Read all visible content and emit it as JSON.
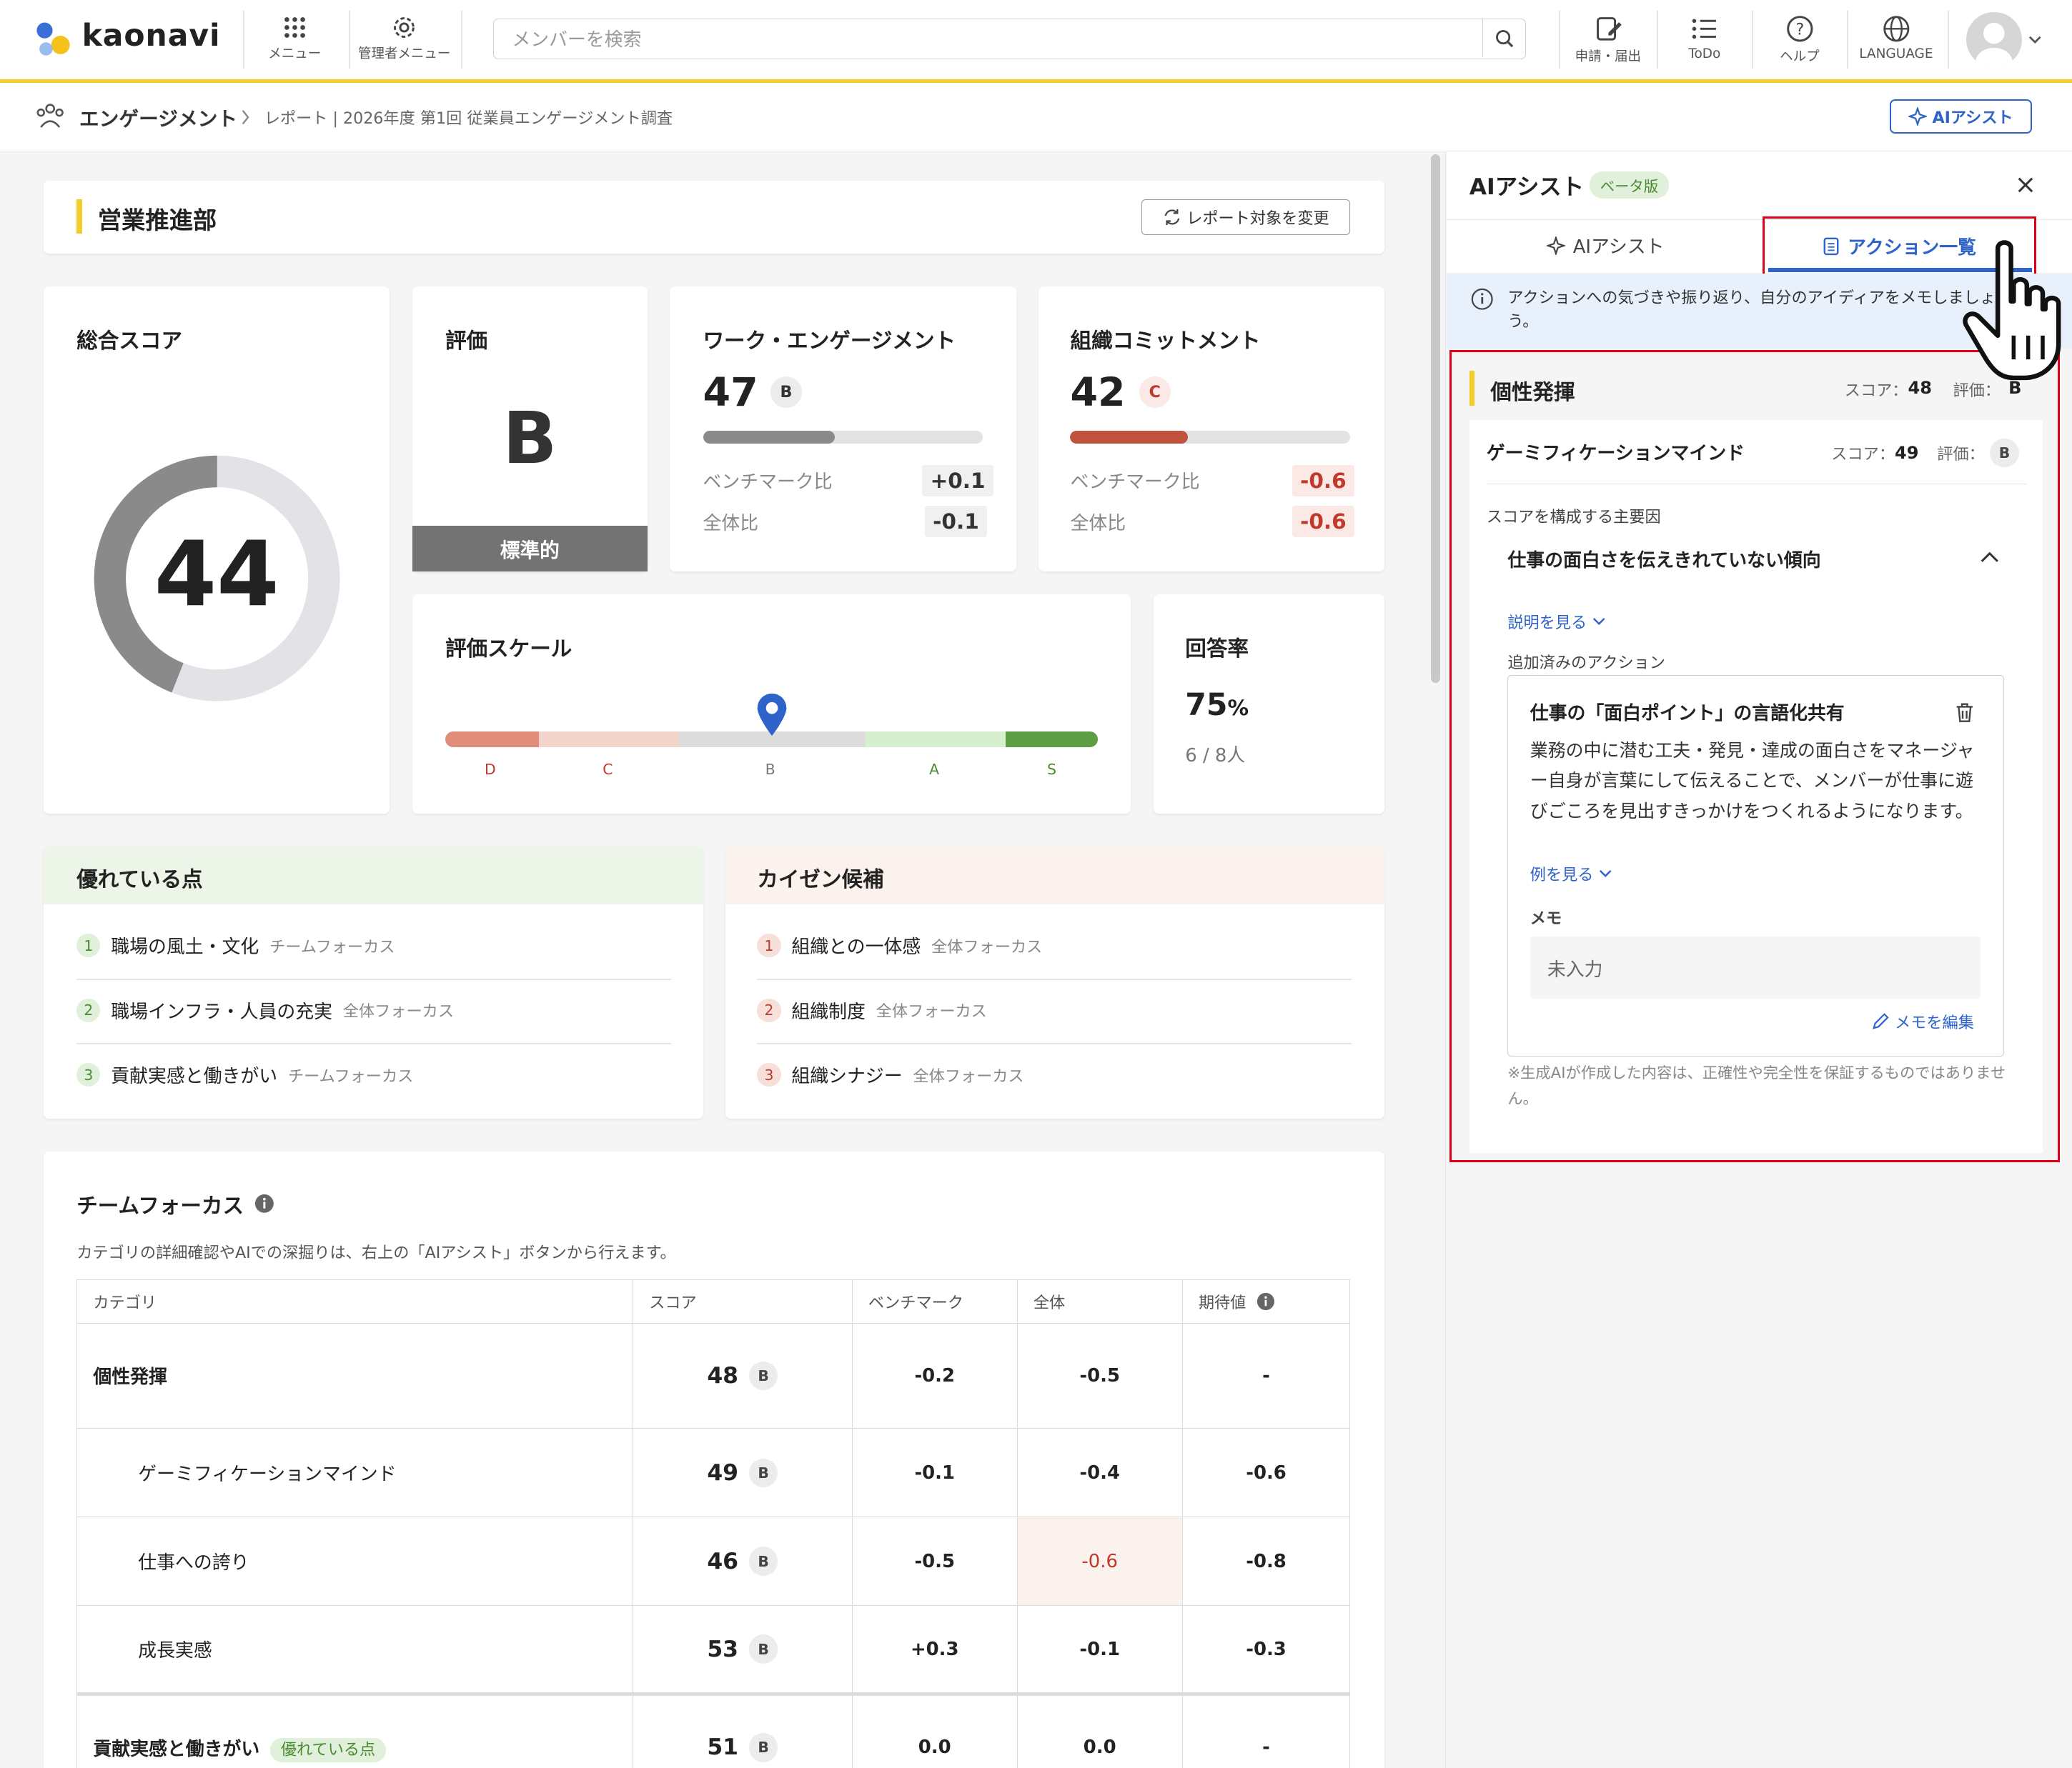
{
  "header": {
    "logo": "kaonavi",
    "nav": [
      {
        "label": "メニュー",
        "icon": "grid-icon"
      },
      {
        "label": "管理者メニュー",
        "icon": "gear-icon"
      }
    ],
    "search_placeholder": "メンバーを検索",
    "right_nav": [
      {
        "label": "申請・届出",
        "icon": "application-icon"
      },
      {
        "label": "ToDo",
        "icon": "todo-list-icon"
      },
      {
        "label": "ヘルプ",
        "icon": "help-icon"
      },
      {
        "label": "LANGUAGE",
        "icon": "globe-icon"
      }
    ]
  },
  "breadcrumb": {
    "section": "エンゲージメント",
    "report": "レポート | 2026年度 第1回 従業員エンゲージメント調査",
    "ai_button": "AIアシスト"
  },
  "department": {
    "name": "営業推進部",
    "change_button": "レポート対象を変更"
  },
  "overall": {
    "title": "総合スコア",
    "score": "44",
    "fraction": 0.44
  },
  "evaluation": {
    "title": "評価",
    "grade": "B",
    "label": "標準的"
  },
  "work_engagement": {
    "title": "ワーク・エンゲージメント",
    "score": "47",
    "grade": "B",
    "fraction": 0.47,
    "benchmark_label": "ベンチマーク比",
    "benchmark": "+0.1",
    "overall_label": "全体比",
    "overall": "-0.1"
  },
  "org_commitment": {
    "title": "組織コミットメント",
    "score": "42",
    "grade": "C",
    "fraction": 0.42,
    "benchmark_label": "ベンチマーク比",
    "benchmark": "-0.6",
    "overall_label": "全体比",
    "overall": "-0.6"
  },
  "scale": {
    "title": "評価スケール",
    "labels": [
      "D",
      "C",
      "B",
      "A",
      "S"
    ],
    "position": 0.5
  },
  "response": {
    "title": "回答率",
    "rate": "75",
    "unit": "%",
    "count": "6 / 8人"
  },
  "strengths": {
    "title": "優れている点",
    "items": [
      {
        "num": "1",
        "name": "職場の風土・文化",
        "tag": "チームフォーカス"
      },
      {
        "num": "2",
        "name": "職場インフラ・人員の充実",
        "tag": "全体フォーカス"
      },
      {
        "num": "3",
        "name": "貢献実感と働きがい",
        "tag": "チームフォーカス"
      }
    ]
  },
  "kaizen": {
    "title": "カイゼン候補",
    "items": [
      {
        "num": "1",
        "name": "組織との一体感",
        "tag": "全体フォーカス"
      },
      {
        "num": "2",
        "name": "組織制度",
        "tag": "全体フォーカス"
      },
      {
        "num": "3",
        "name": "組織シナジー",
        "tag": "全体フォーカス"
      }
    ]
  },
  "team_focus": {
    "title": "チームフォーカス",
    "description": "カテゴリの詳細確認やAIでの深掘りは、右上の「AIアシスト」ボタンから行えます。",
    "columns": [
      "カテゴリ",
      "スコア",
      "ベンチマーク",
      "全体",
      "期待値"
    ],
    "rows": [
      {
        "category": "個性発揮",
        "score": "48",
        "grade": "B",
        "benchmark": "-0.2",
        "overall": "-0.5",
        "expected": "-"
      },
      {
        "category": "ゲーミフィケーションマインド",
        "score": "49",
        "grade": "B",
        "benchmark": "-0.1",
        "overall": "-0.4",
        "expected": "-0.6"
      },
      {
        "category": "仕事への誇り",
        "score": "46",
        "grade": "B",
        "benchmark": "-0.5",
        "overall": "-0.6",
        "expected": "-0.8"
      },
      {
        "category": "成長実感",
        "score": "53",
        "grade": "B",
        "benchmark": "+0.3",
        "overall": "-0.1",
        "expected": "-0.3"
      },
      {
        "category": "貢献実感と働きがい",
        "tag": "優れている点",
        "score": "51",
        "grade": "B",
        "benchmark": "0.0",
        "overall": "0.0",
        "expected": "-"
      }
    ]
  },
  "ai_panel": {
    "title": "AIアシスト",
    "beta": "ベータ版",
    "tabs": [
      "AIアシスト",
      "アクション一覧"
    ],
    "info": "アクションへの気づきや振り返り、自分のアイディアをメモしましょう。",
    "category": {
      "name": "個性発揮",
      "score_label": "スコア：",
      "score": "48",
      "grade_label": "評価：",
      "grade": "B"
    },
    "sub": {
      "name": "ゲーミフィケーションマインド",
      "score_label": "スコア：",
      "score": "49",
      "grade_label": "評価：",
      "grade": "B"
    },
    "factors_label": "スコアを構成する主要因",
    "factor": "仕事の面白さを伝えきれていない傾向",
    "explain_link": "説明を見る",
    "added_label": "追加済みのアクション",
    "action": {
      "title": "仕事の「面白ポイント」の言語化共有",
      "body": "業務の中に潜む工夫・発見・達成の面白さをマネージャー自身が言葉にして伝えることで、メンバーが仕事に遊びごころを見出すきっかけをつくれるようになります。",
      "example_link": "例を見る",
      "memo_label": "メモ",
      "memo_value": "未入力",
      "edit_memo": "メモを編集"
    },
    "disclaimer": "※生成AIが作成した内容は、正確性や完全性を保証するものではありません。"
  },
  "colors": {
    "accent_yellow": "#f4cd2a",
    "primary_blue": "#2e63c9",
    "negative_red": "#c0392b",
    "highlight_red": "#e0001a"
  }
}
